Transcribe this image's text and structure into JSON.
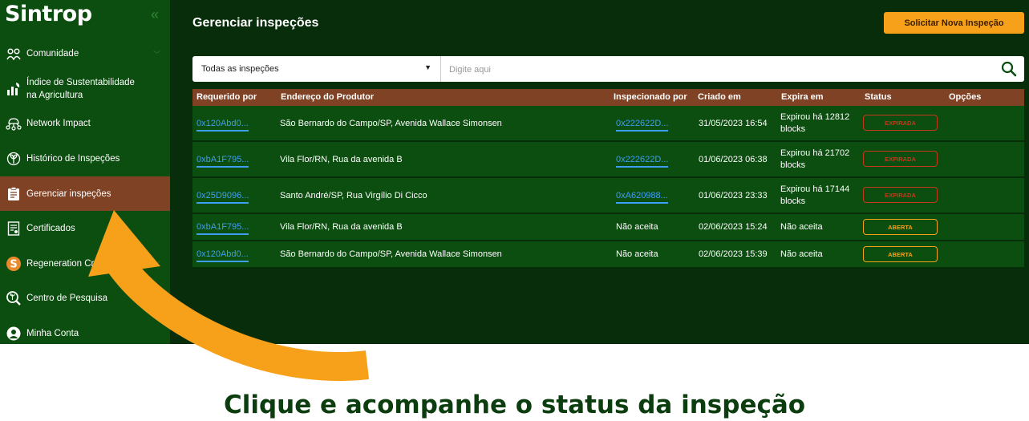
{
  "sidebar": {
    "logo": "Sintrop",
    "items": [
      {
        "label": "Comunidade",
        "icon": "community-icon"
      },
      {
        "label": "Índice de Sustentabilidade na Agricultura",
        "icon": "sustainability-index-icon"
      },
      {
        "label": "Network Impact",
        "icon": "network-impact-icon"
      },
      {
        "label": "Histórico de Inspeções",
        "icon": "plant-icon"
      },
      {
        "label": "Gerenciar inspeções",
        "icon": "clipboard-icon",
        "active": true
      },
      {
        "label": "Certificados",
        "icon": "certificate-icon"
      },
      {
        "label": "Regeneration Credit",
        "icon": "coin-icon"
      },
      {
        "label": "Centro de Pesquisa",
        "icon": "research-icon"
      },
      {
        "label": "Minha Conta",
        "icon": "user-icon"
      }
    ]
  },
  "header": {
    "title": "Gerenciar inspeções",
    "new_button": "Solicitar Nova Inspeção"
  },
  "filter": {
    "selected": "Todas as inspeções",
    "search_placeholder": "Digite aqui"
  },
  "table": {
    "columns": [
      "Requerido por",
      "Endereço do Produtor",
      "Inspecionado por",
      "Criado em",
      "Expira em",
      "Status",
      "Opções"
    ],
    "rows": [
      {
        "requested_by": "0x120Abd0...",
        "address": "São Bernardo do Campo/SP, Avenida Wallace Simonsen",
        "inspected_by": "0x222622D...",
        "created": "31/05/2023 16:54",
        "expires": "Expirou há 12812 blocks",
        "status": "EXPIRADA"
      },
      {
        "requested_by": "0xbA1F795...",
        "address": "Vila Flor/RN, Rua da avenida B",
        "inspected_by": "0x222622D...",
        "created": "01/06/2023 06:38",
        "expires": "Expirou há 21702 blocks",
        "status": "EXPIRADA"
      },
      {
        "requested_by": "0x25D9096...",
        "address": "Santo André/SP, Rua Virgílio Di Cicco",
        "inspected_by": "0xA620988...",
        "created": "01/06/2023 23:33",
        "expires": "Expirou há 17144 blocks",
        "status": "EXPIRADA"
      },
      {
        "requested_by": "0xbA1F795...",
        "address": "Vila Flor/RN, Rua da avenida B",
        "inspected_by": "Não aceita",
        "created": "02/06/2023 15:24",
        "expires": "Não aceita",
        "status": "ABERTA"
      },
      {
        "requested_by": "0x120Abd0...",
        "address": "São Bernardo do Campo/SP, Avenida Wallace Simonsen",
        "inspected_by": "Não aceita",
        "created": "02/06/2023 15:39",
        "expires": "Não aceita",
        "status": "ABERTA"
      }
    ]
  },
  "caption": "Clique e acompanhe o status da inspeção",
  "colors": {
    "background": "#082d0a",
    "sidebar": "#0c4d10",
    "accent_brown": "#804224",
    "orange": "#f7a11a",
    "link_blue": "#3e9df5",
    "expired_red": "#c8371b"
  }
}
